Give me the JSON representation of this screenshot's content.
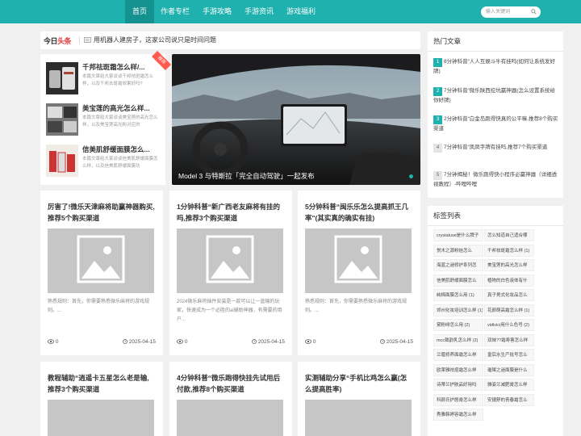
{
  "nav": {
    "items": [
      "首页",
      "作者专栏",
      "手游攻略",
      "手游资讯",
      "游戏福利"
    ],
    "search_placeholder": "输入关键词"
  },
  "topbar": {
    "logo_part1": "今日",
    "logo_part2": "头条",
    "ticker": "用机器人建房子，这家公司说只是时间问题"
  },
  "side_list": {
    "badge": "推荐",
    "items": [
      {
        "title": "千邦祛斑霜怎么样/...",
        "desc": "本篇文章给大家谈谈千邦祛斑霜怎么样，以及千邦去斑霜效果好吗?"
      },
      {
        "title": "美宝莲的高光怎么样...",
        "desc": "本篇文章给大家谈谈美宝莲的高光怎么样，以及美宝莲高光粉对应的"
      },
      {
        "title": "信美肌舒缓面膜怎么...",
        "desc": "本篇文章给大家谈谈信美肌舒缓面膜怎么样，以及信美肌舒缓面膜功"
      }
    ]
  },
  "slider": {
    "caption": "Model 3 与特斯拉「完全自动驾驶」一起发布"
  },
  "posts": [
    {
      "title": "厉害了!微乐天津麻将助赢神器购买,推荐5个购买渠道",
      "excerpt": "熟悉规则：首先，你需要熟悉微乐麻将的游戏规则。...",
      "views": "0",
      "date": "2025-04-15"
    },
    {
      "title": "1分钟科普“新广西老友麻将有挂的吗,推荐3个购买渠道",
      "excerpt": "2024微乐麻将插件安装是一款可以让一直输的玩家，快速成为一个必胜的ai辅助神器，有需要的用户...",
      "views": "0",
      "date": "2025-04-15"
    },
    {
      "title": "5分钟科普“闽乐乐怎么提高抓王几率\"(其实真的确实有挂)",
      "excerpt": "熟悉规则：首先，你需要熟悉微乐麻将的游戏规则。...",
      "views": "0",
      "date": "2025-04-15"
    }
  ],
  "posts2": [
    {
      "title": "教程辅助“逍遥卡五星怎么老是输,推荐3个购买渠道"
    },
    {
      "title": "4分钟科普“微乐跑得快挂先试用后付款,推荐8个购买渠道"
    },
    {
      "title": "实测辅助分享“手机比鸡怎么赢(怎么提高胜率)"
    }
  ],
  "hot": {
    "title": "热门文章",
    "items": [
      {
        "rank": "1",
        "text": "8分钟科普“人人互娱斗牛有挂吗(如何让系统发好牌)"
      },
      {
        "rank": "2",
        "text": "7分钟科普“微乐陕西挖坑赢神器(怎么设置系统给你好牌)"
      },
      {
        "rank": "3",
        "text": "2分钟科普“白金岛跑得快真的公平嘛,推荐8个购买渠道"
      },
      {
        "rank": "4",
        "text": "7分钟科普“凤凤字牌有挂吗,推荐7个购买渠道"
      },
      {
        "rank": "5",
        "text": "7分钟揭秘！微乐跑得快小程序必赢神器（详细透视教程）-哔哩哔哩"
      }
    ]
  },
  "tags": {
    "title": "标签列表",
    "items": [
      "crystaluxe是什么牌子",
      "怎么知道自己适合哪",
      "悦木之源粉娃怎么",
      "千邦祛斑霜怎么样 (1)",
      "海蓝之谜修护系列怎",
      "美宝莲的高光怎么样",
      "信美肌舒缓面膜怎么",
      "植物的白色液体有什",
      "純棉面膜怎么用 (1)",
      "真子男式化妆品怎么",
      "郊州化妆培训怎么样 (1)",
      "花颜萌高霜怎么样 (1)",
      "黛粉绯怎么用 (2)",
      "vidivici用什么色号 (2)",
      "mcc致韵乳怎么样 (2)",
      "双妹??霜寿害怎么样",
      "兰蔻修养面霜怎么样",
      "皇后水生产批号怎么",
      "欧莱雅祛痘霜怎么样",
      "璀璨之谜面膜是什么",
      "诗蒂兰护肤品好用吗",
      "雅姿兰减肥膏怎么样",
      "科颜氏护唇膏怎么样",
      "安捷舒的青春霜怎么",
      "秀雅韩婷容霜怎么样"
    ]
  },
  "colors": {
    "accent": "#1fb1ad",
    "badge": "#ff5a4d"
  }
}
